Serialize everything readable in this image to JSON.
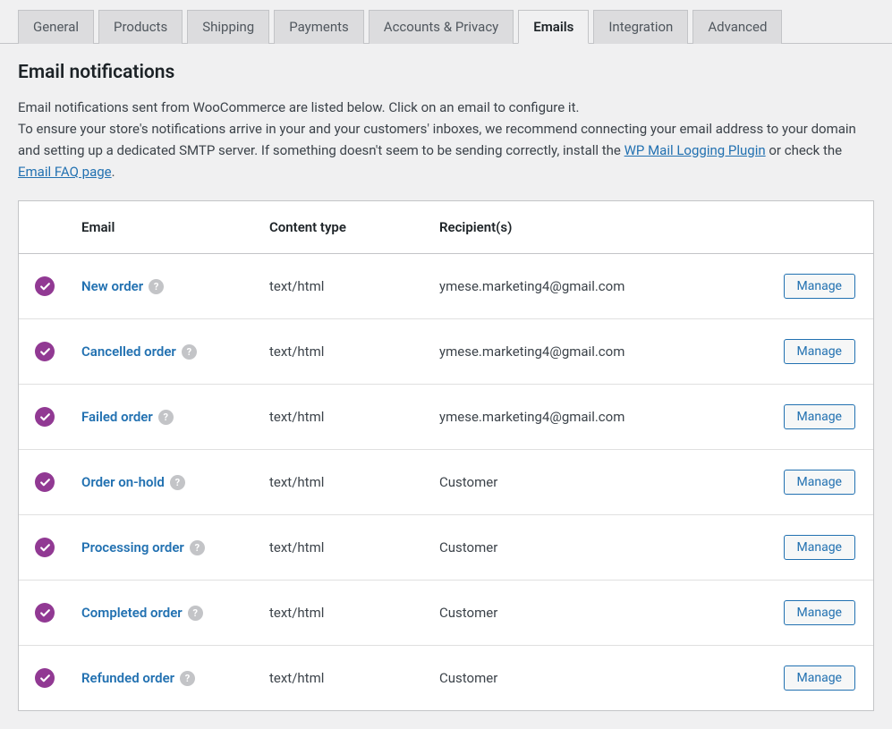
{
  "tabs": [
    {
      "label": "General",
      "active": false
    },
    {
      "label": "Products",
      "active": false
    },
    {
      "label": "Shipping",
      "active": false
    },
    {
      "label": "Payments",
      "active": false
    },
    {
      "label": "Accounts & Privacy",
      "active": false
    },
    {
      "label": "Emails",
      "active": true
    },
    {
      "label": "Integration",
      "active": false
    },
    {
      "label": "Advanced",
      "active": false
    }
  ],
  "heading": "Email notifications",
  "description": {
    "line1": "Email notifications sent from WooCommerce are listed below. Click on an email to configure it.",
    "line2_a": "To ensure your store's notifications arrive in your and your customers' inboxes, we recommend connecting your email address to your domain and setting up a dedicated SMTP server. If something doesn't seem to be sending correctly, install the ",
    "link1": "WP Mail Logging Plugin",
    "line2_b": " or check the ",
    "link2": "Email FAQ page",
    "line2_c": "."
  },
  "table": {
    "headers": {
      "email": "Email",
      "content_type": "Content type",
      "recipients": "Recipient(s)"
    },
    "manage_label": "Manage",
    "help_glyph": "?",
    "rows": [
      {
        "name": "New order",
        "content_type": "text/html",
        "recipient": "ymese.marketing4@gmail.com"
      },
      {
        "name": "Cancelled order",
        "content_type": "text/html",
        "recipient": "ymese.marketing4@gmail.com"
      },
      {
        "name": "Failed order",
        "content_type": "text/html",
        "recipient": "ymese.marketing4@gmail.com"
      },
      {
        "name": "Order on-hold",
        "content_type": "text/html",
        "recipient": "Customer"
      },
      {
        "name": "Processing order",
        "content_type": "text/html",
        "recipient": "Customer"
      },
      {
        "name": "Completed order",
        "content_type": "text/html",
        "recipient": "Customer"
      },
      {
        "name": "Refunded order",
        "content_type": "text/html",
        "recipient": "Customer"
      }
    ]
  }
}
